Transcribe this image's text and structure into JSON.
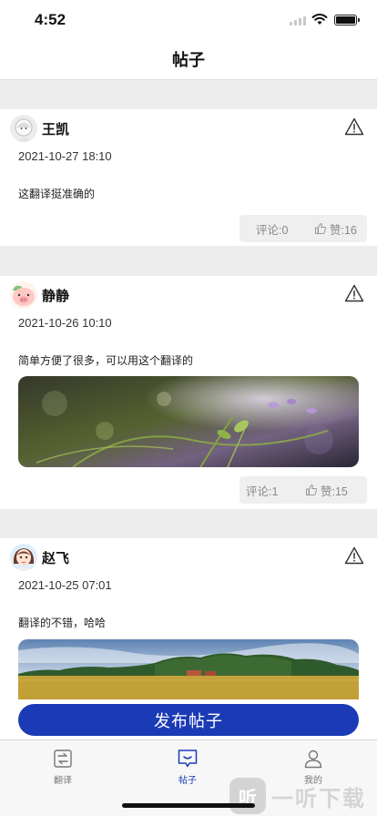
{
  "status_bar": {
    "time": "4:52"
  },
  "header": {
    "title": "帖子"
  },
  "posts": [
    {
      "author": "王凯",
      "avatar": "avatar-white-hood",
      "timestamp": "2021-10-27 18:10",
      "content": "这翻译挺准确的",
      "image": null,
      "comments": "评论:0",
      "likes": "赞:16"
    },
    {
      "author": "静静",
      "avatar": "avatar-pink-pig",
      "timestamp": "2021-10-26 10:10",
      "content": "简单方便了很多，可以用这个翻译的",
      "image": "grass-flowers-photo",
      "comments": "评论:1",
      "likes": "赞:15"
    },
    {
      "author": "赵飞",
      "avatar": "avatar-cartoon-girl",
      "timestamp": "2021-10-25 07:01",
      "content": "翻译的不错，哈哈",
      "image": "field-landscape-photo"
    }
  ],
  "publish_button": "发布帖子",
  "tabs": [
    {
      "label": "翻译",
      "icon": "translate-icon",
      "active": false
    },
    {
      "label": "帖子",
      "icon": "chat-icon",
      "active": true
    },
    {
      "label": "我的",
      "icon": "person-icon",
      "active": false
    }
  ],
  "watermark": {
    "logo": "听",
    "text": "一听下载"
  },
  "colors": {
    "accent": "#1a3bb5",
    "background": "#ededed",
    "stats_bg": "#efefef"
  }
}
